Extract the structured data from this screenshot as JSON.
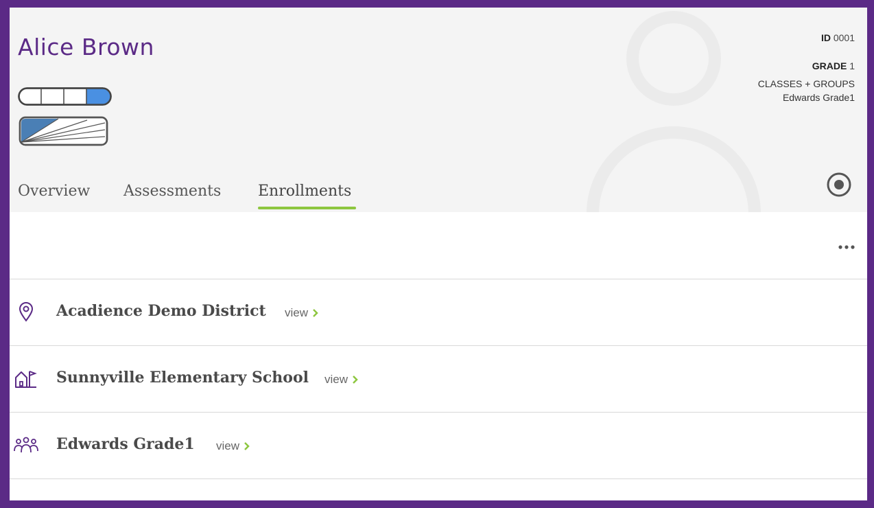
{
  "student": {
    "name": "Alice Brown"
  },
  "meta": {
    "id_label": "ID",
    "id_value": "0001",
    "grade_label": "GRADE",
    "grade_value": "1",
    "classes_label": "CLASSES + GROUPS",
    "classes_value": "Edwards Grade1"
  },
  "tabs": [
    {
      "label": "Overview",
      "active": false
    },
    {
      "label": "Assessments",
      "active": false
    },
    {
      "label": "Enrollments",
      "active": true
    }
  ],
  "enrollments": [
    {
      "title": "Acadience Demo District",
      "link": "view",
      "icon": "location-pin-icon"
    },
    {
      "title": "Sunnyville Elementary School",
      "link": "view",
      "icon": "school-icon"
    },
    {
      "title": "Edwards Grade1",
      "link": "view",
      "icon": "group-icon"
    }
  ],
  "colors": {
    "brand_purple": "#5b2a86",
    "accent_green": "#8dc63f",
    "meter_blue": "#4a90e2"
  }
}
